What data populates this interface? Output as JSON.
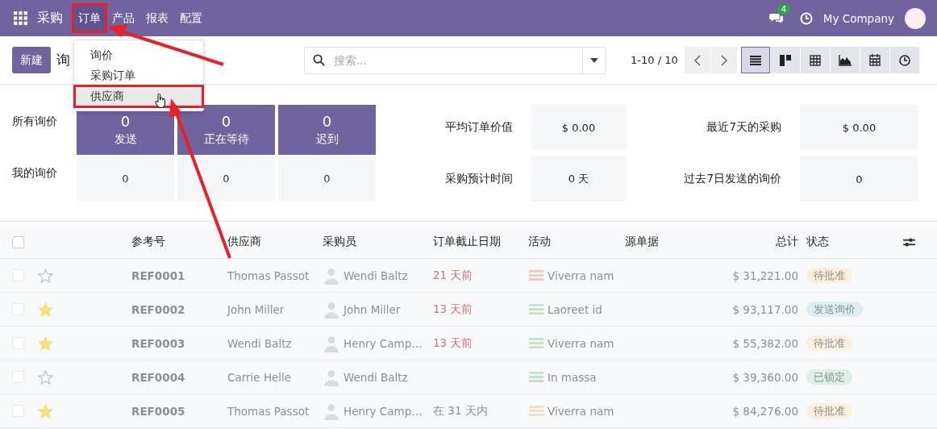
{
  "navbar": {
    "app": "采购",
    "menus": [
      {
        "label": "订单",
        "selected": true,
        "annotated": true
      },
      {
        "label": "产品",
        "selected": false,
        "annotated": false
      },
      {
        "label": "报表",
        "selected": false,
        "annotated": false
      },
      {
        "label": "配置",
        "selected": false,
        "annotated": false
      }
    ],
    "message_count": "4",
    "company": "My Company"
  },
  "dropdown": [
    {
      "label": "询价",
      "hovered": false,
      "annotated": false
    },
    {
      "label": "采购订单",
      "hovered": false,
      "annotated": false
    },
    {
      "label": "供应商",
      "hovered": true,
      "annotated": true
    }
  ],
  "control_panel": {
    "new_button": "新建",
    "title": "询",
    "search_placeholder": "搜索...",
    "pager": "1-10 / 10",
    "views": [
      {
        "kind": "list",
        "selected": true
      },
      {
        "kind": "kanban",
        "selected": false
      },
      {
        "kind": "pivot",
        "selected": false
      },
      {
        "kind": "graph",
        "selected": false
      },
      {
        "kind": "calendar",
        "selected": false
      },
      {
        "kind": "activity",
        "selected": false
      }
    ]
  },
  "stats_left": [
    {
      "label": "所有询价",
      "kind": "highlight",
      "tiles": [
        {
          "value": "0",
          "label": "发送"
        },
        {
          "value": "0",
          "label": "正在等待"
        },
        {
          "value": "0",
          "label": "迟到"
        }
      ]
    },
    {
      "label": "我的询价",
      "kind": "plain",
      "tiles": [
        {
          "value": "0"
        },
        {
          "value": "0"
        },
        {
          "value": "0"
        }
      ]
    }
  ],
  "stats_right": [
    {
      "label": "平均订单价值",
      "value": "$ 0.00"
    },
    {
      "label": "最近7天的采购",
      "value": "$ 0.00"
    },
    {
      "label": "采购预计时间",
      "value": "0 天"
    },
    {
      "label": "过去7日发送的询价",
      "value": "0"
    }
  ],
  "table": {
    "all_checked": false,
    "columns": [
      "参考号",
      "供应商",
      "采购员",
      "订单截止日期",
      "活动",
      "源单据",
      "总计",
      "状态"
    ],
    "rows": [
      {
        "checked": false,
        "starred": false,
        "ref": "REF0001",
        "vendor": "Thomas Passot",
        "buyer": "Wendi Baltz",
        "deadline": "21 天前",
        "deadline_overdue": true,
        "activity": {
          "text": "Viverra nam",
          "color": "#f3c4c4"
        },
        "total": "$ 31,221.00",
        "status": {
          "text": "待批准",
          "color": "#fcefdc"
        }
      },
      {
        "checked": false,
        "starred": true,
        "ref": "REF0002",
        "vendor": "John Miller",
        "buyer": "John Miller",
        "deadline": "13 天前",
        "deadline_overdue": true,
        "activity": {
          "text": "Laoreet id",
          "color": "#bfe3c6"
        },
        "total": "$ 93,117.00",
        "status": {
          "text": "发送询价",
          "color": "#dcf0f4"
        }
      },
      {
        "checked": false,
        "starred": true,
        "ref": "REF0003",
        "vendor": "Wendi Baltz",
        "buyer": "Henry Camp…",
        "deadline": "13 天前",
        "deadline_overdue": true,
        "activity": {
          "text": "Viverra nam",
          "color": "#bfe3c6"
        },
        "total": "$ 55,382.00",
        "status": {
          "text": "待批准",
          "color": "#fcefdc"
        }
      },
      {
        "checked": false,
        "starred": false,
        "ref": "REF0004",
        "vendor": "Carrie Helle",
        "buyer": "Wendi Baltz",
        "activity": {
          "text": "In massa",
          "color": "#bfe3c6"
        },
        "total": "$ 39,360.00",
        "status": {
          "text": "已锁定",
          "color": "#dcf1e1"
        }
      },
      {
        "checked": false,
        "starred": true,
        "ref": "REF0005",
        "vendor": "Thomas Passot",
        "buyer": "Henry Camp…",
        "deadline": "在 31 天内",
        "deadline_overdue": false,
        "activity": {
          "text": "Viverra nam",
          "color": "#f6dcbc"
        },
        "total": "$ 84,276.00",
        "status": {
          "text": "待批准",
          "color": "#fcefdc"
        }
      }
    ]
  }
}
